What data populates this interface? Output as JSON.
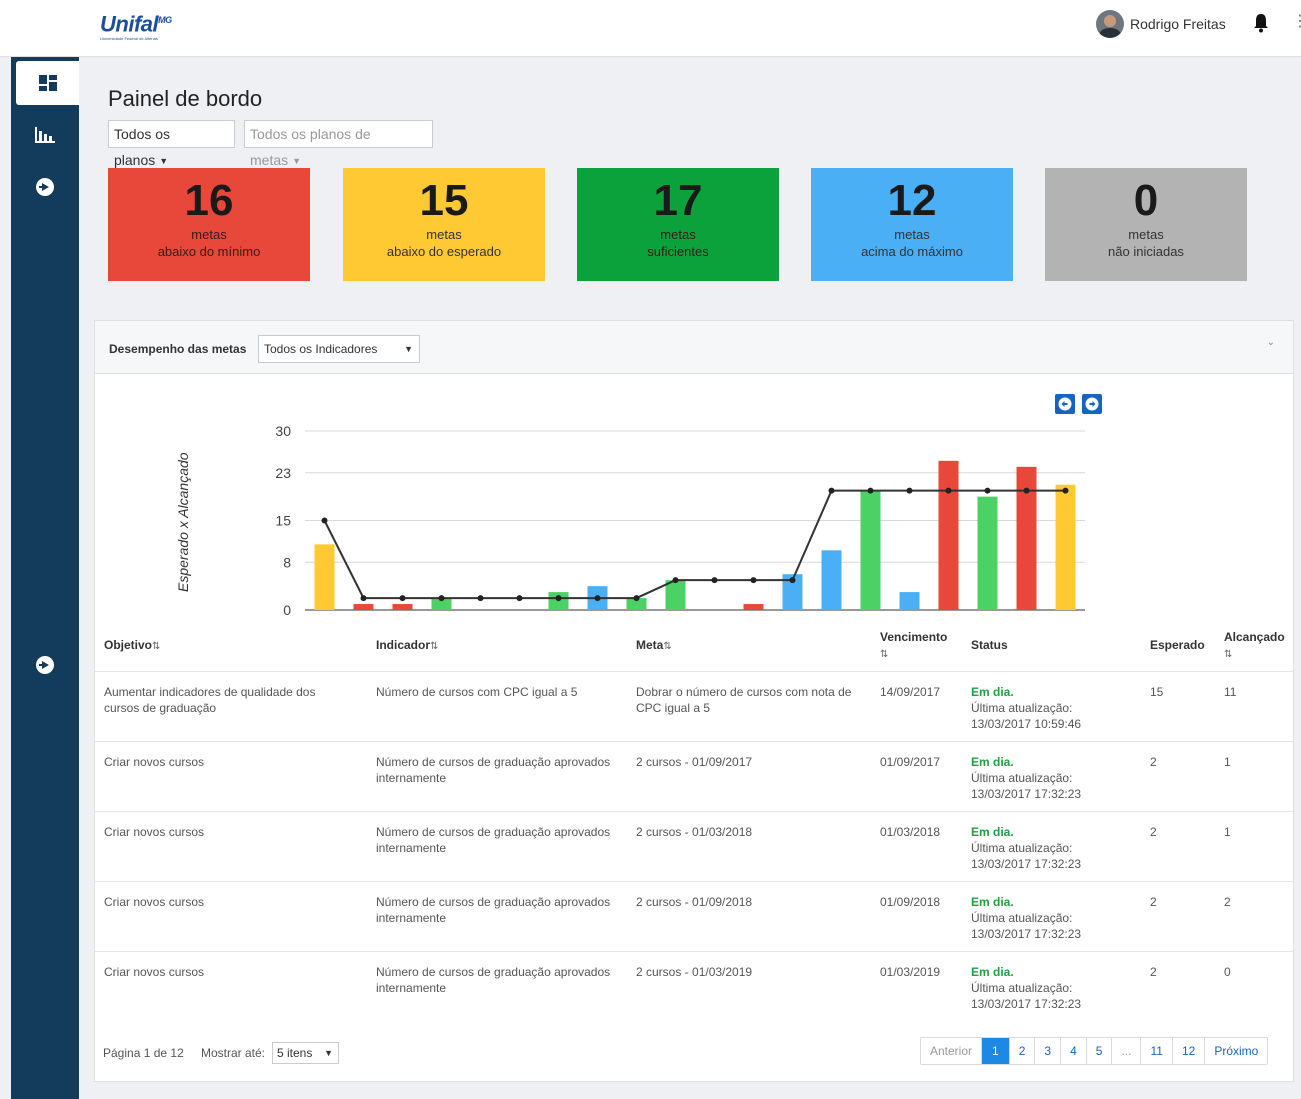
{
  "header": {
    "logo_text": "Unifal",
    "logo_super": "MG",
    "logo_sub": "Universidade Federal de Alfenas",
    "user_name": "Rodrigo Freitas"
  },
  "sidebar": {
    "items": [
      {
        "name": "dashboard-icon"
      },
      {
        "name": "bar-chart-icon"
      },
      {
        "name": "arrow-right-circle-icon"
      },
      {
        "name": "arrow-right-circle-icon"
      }
    ]
  },
  "page": {
    "title": "Painel de bordo",
    "filter_plans": "Todos os planos",
    "filter_goal_plans": "Todos os planos de metas"
  },
  "cards": [
    {
      "value": "16",
      "line1": "metas",
      "line2": "abaixo do mínimo",
      "color": "#e8483a"
    },
    {
      "value": "15",
      "line1": "metas",
      "line2": "abaixo do esperado",
      "color": "#ffc933"
    },
    {
      "value": "17",
      "line1": "metas",
      "line2": "suficientes",
      "color": "#0ba13b"
    },
    {
      "value": "12",
      "line1": "metas",
      "line2": "acima do máximo",
      "color": "#4aaff5"
    },
    {
      "value": "0",
      "line1": "metas",
      "line2": "não iniciadas",
      "color": "#b4b3b3"
    }
  ],
  "panel": {
    "title": "Desempenho das metas",
    "indicator_select": "Todos os Indicadores"
  },
  "chart_data": {
    "type": "bar",
    "ylabel": "Esperado x Alcançado",
    "ylim": [
      0,
      30
    ],
    "yticks": [
      "0",
      "8",
      "15",
      "23",
      "30"
    ],
    "grid": true,
    "series": [
      {
        "type": "bar",
        "values": [
          11,
          1,
          1,
          2,
          0,
          0,
          3,
          4,
          2,
          5,
          0,
          1,
          6,
          10,
          20,
          3,
          25,
          19,
          24,
          21
        ]
      },
      {
        "type": "line",
        "values": [
          15,
          2,
          2,
          2,
          2,
          2,
          2,
          2,
          2,
          5,
          5,
          5,
          5,
          20,
          20,
          20,
          20,
          20,
          20,
          20
        ]
      }
    ],
    "bar_colors": [
      "#ffc933",
      "#e8483a",
      "#e8483a",
      "#4cd264",
      "#e8483a",
      "#e8483a",
      "#4cd264",
      "#4aaff5",
      "#4cd264",
      "#4cd264",
      "#e8483a",
      "#e8483a",
      "#4aaff5",
      "#4aaff5",
      "#4cd264",
      "#4aaff5",
      "#e8483a",
      "#4cd264",
      "#e8483a",
      "#ffc933"
    ]
  },
  "table": {
    "headers": {
      "objetivo": "Objetivo",
      "indicador": "Indicador",
      "meta": "Meta",
      "vencimento": "Vencimento",
      "status": "Status",
      "esperado": "Esperado",
      "alcancado": "Alcançado"
    },
    "rows": [
      {
        "objetivo": "Aumentar indicadores de qualidade dos cursos de graduação",
        "indicador": "Número de cursos com CPC igual a 5",
        "meta": "Dobrar o número de cursos com nota de CPC igual a 5",
        "vencimento": "14/09/2017",
        "status": "Em dia.",
        "update_label": "Última atualização:",
        "update_time": "13/03/2017 10:59:46",
        "esperado": "15",
        "alcancado": "11"
      },
      {
        "objetivo": "Criar novos cursos",
        "indicador": "Número de cursos de graduação aprovados internamente",
        "meta": "2 cursos - 01/09/2017",
        "vencimento": "01/09/2017",
        "status": "Em dia.",
        "update_label": "Última atualização:",
        "update_time": "13/03/2017 17:32:23",
        "esperado": "2",
        "alcancado": "1"
      },
      {
        "objetivo": "Criar novos cursos",
        "indicador": "Número de cursos de graduação aprovados internamente",
        "meta": "2 cursos - 01/03/2018",
        "vencimento": "01/03/2018",
        "status": "Em dia.",
        "update_label": "Última atualização:",
        "update_time": "13/03/2017 17:32:23",
        "esperado": "2",
        "alcancado": "1"
      },
      {
        "objetivo": "Criar novos cursos",
        "indicador": "Número de cursos de graduação aprovados internamente",
        "meta": "2 cursos - 01/09/2018",
        "vencimento": "01/09/2018",
        "status": "Em dia.",
        "update_label": "Última atualização:",
        "update_time": "13/03/2017 17:32:23",
        "esperado": "2",
        "alcancado": "2"
      },
      {
        "objetivo": "Criar novos cursos",
        "indicador": "Número de cursos de graduação aprovados internamente",
        "meta": "2 cursos - 01/03/2019",
        "vencimento": "01/03/2019",
        "status": "Em dia.",
        "update_label": "Última atualização:",
        "update_time": "13/03/2017 17:32:23",
        "esperado": "2",
        "alcancado": "0"
      }
    ]
  },
  "footer": {
    "page_info": "Página 1 de 12",
    "show_label": "Mostrar até:",
    "show_value": "5 itens",
    "pager": [
      "Anterior",
      "1",
      "2",
      "3",
      "4",
      "5",
      "...",
      "11",
      "12",
      "Próximo"
    ]
  }
}
